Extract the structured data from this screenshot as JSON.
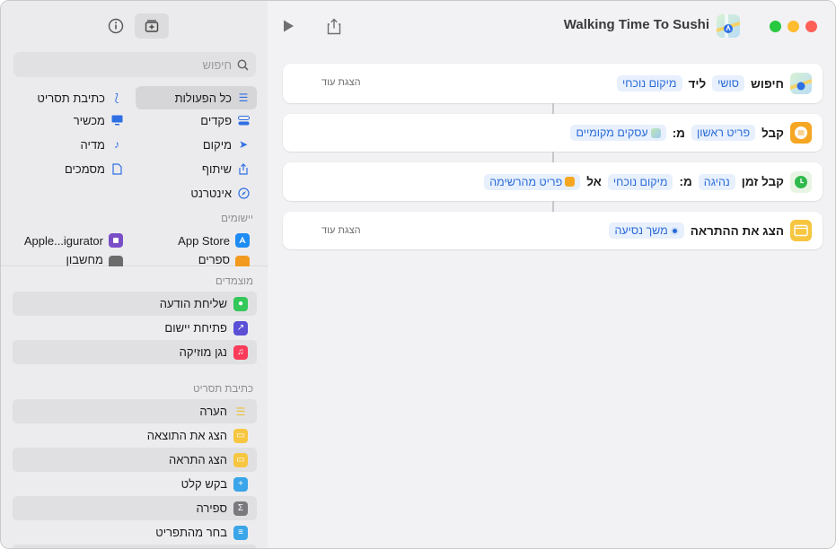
{
  "window": {
    "title": "Walking Time To Sushi",
    "traffic_colors": {
      "close": "#ff5f57",
      "minimize": "#febc2e",
      "zoom": "#28c840"
    }
  },
  "toolbar": {
    "run_icon": "play-icon",
    "share_icon": "share-icon"
  },
  "actions": [
    {
      "verb": "חיפוש",
      "tokens": [
        "סושי",
        "מיקום נוכחי"
      ],
      "connector_word": "ליד",
      "show_more": "הצגת עוד"
    },
    {
      "verb": "קבל",
      "token1": "פריט ראשון",
      "from": "מ:",
      "token2": "עסקים מקומיים"
    },
    {
      "verb": "קבל זמן",
      "token1": "נהיגה",
      "from": "מ:",
      "token2": "מיקום נוכחי",
      "to": "אל",
      "token3": "פריט מהרשימה"
    },
    {
      "verb": "הצג את ההתראה",
      "token1": "משך נסיעה",
      "show_more": "הצגת עוד"
    }
  ],
  "sidebar": {
    "search_placeholder": "חיפוש",
    "categories_right": [
      "כל הפעולות",
      "פקדים",
      "מיקום",
      "שיתוף",
      "אינטרנט"
    ],
    "categories_left": [
      "כתיבת תסריט",
      "מכשיר",
      "מדיה",
      "מסמכים"
    ],
    "apps_label": "יישומים",
    "apps": [
      {
        "name": "App Store"
      },
      {
        "name": "Apple...igurator"
      },
      {
        "name": "ספרים"
      },
      {
        "name": "מחשבון"
      }
    ],
    "suggested_label": "מוצמדים",
    "suggested": [
      "שליחת הודעה",
      "פתיחת יישום",
      "נגן מוזיקה"
    ],
    "scripting_label": "כתיבת תסריט",
    "scripting": [
      "הערה",
      "הצג את התוצאה",
      "הצג התראה",
      "בקש קלט",
      "ספירה",
      "בחר מהתפריט"
    ]
  }
}
